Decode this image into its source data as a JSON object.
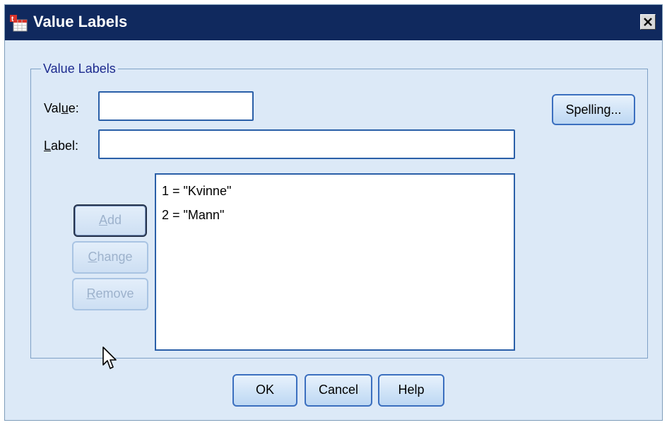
{
  "window": {
    "title": "Value Labels",
    "icon": "spss-data-icon",
    "close_icon": "close-icon"
  },
  "group": {
    "legend": "Value Labels"
  },
  "form": {
    "value_label_pre": "Val",
    "value_label_ul": "u",
    "value_label_post": "e:",
    "value_input": "",
    "label_label_ul": "L",
    "label_label_post": "abel:",
    "label_input": ""
  },
  "buttons": {
    "spelling": "Spelling...",
    "add_ul": "A",
    "add_post": "dd",
    "change_ul": "C",
    "change_post": "hange",
    "remove_ul": "R",
    "remove_post": "emove",
    "ok": "OK",
    "cancel": "Cancel",
    "help": "Help"
  },
  "value_labels_list": [
    "1 = \"Kvinne\"",
    "2 = \"Mann\""
  ],
  "colors": {
    "titlebar": "#10295e",
    "dialog_background": "#dce9f7",
    "accent_border": "#2a5fa8"
  }
}
